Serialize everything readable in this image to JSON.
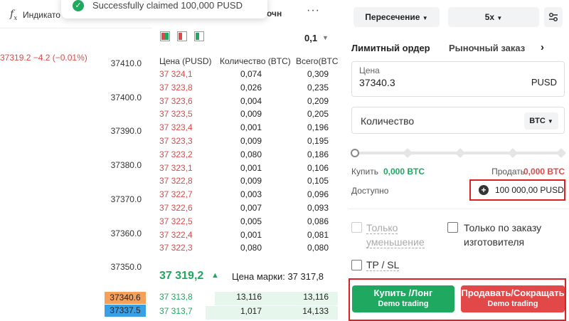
{
  "toast": {
    "message": "Successfully claimed 100,000 PUSD"
  },
  "chart": {
    "indicators_label": "Индикато",
    "price_change": "37319.2  −4.2 (−0.01%)",
    "y_ticks": [
      "37410.0",
      "37400.0",
      "37390.0",
      "37380.0",
      "37370.0",
      "37360.0",
      "37350.0"
    ],
    "price_tags": [
      {
        "value": "37340.6",
        "color": "#f5a15a"
      },
      {
        "value": "37337.5",
        "color": "#3aa0e6"
      }
    ]
  },
  "orderbook": {
    "tab_label": "очн",
    "precision": "0,1",
    "headers": {
      "price": "Цена (PUSD)",
      "qty": "Количество (BTC)",
      "total": "Всего(BTC)"
    },
    "asks": [
      {
        "price": "37 324,1",
        "qty": "0,074",
        "total": "0,309"
      },
      {
        "price": "37 323,8",
        "qty": "0,026",
        "total": "0,235"
      },
      {
        "price": "37 323,6",
        "qty": "0,004",
        "total": "0,209"
      },
      {
        "price": "37 323,5",
        "qty": "0,009",
        "total": "0,205"
      },
      {
        "price": "37 323,4",
        "qty": "0,001",
        "total": "0,196"
      },
      {
        "price": "37 323,3",
        "qty": "0,009",
        "total": "0,195"
      },
      {
        "price": "37 323,2",
        "qty": "0,080",
        "total": "0,186"
      },
      {
        "price": "37 323,1",
        "qty": "0,001",
        "total": "0,106"
      },
      {
        "price": "37 322,8",
        "qty": "0,009",
        "total": "0,105"
      },
      {
        "price": "37 322,7",
        "qty": "0,003",
        "total": "0,096"
      },
      {
        "price": "37 322,6",
        "qty": "0,007",
        "total": "0,093"
      },
      {
        "price": "37 322,5",
        "qty": "0,005",
        "total": "0,086"
      },
      {
        "price": "37 322,4",
        "qty": "0,001",
        "total": "0,081"
      },
      {
        "price": "37 322,3",
        "qty": "0,080",
        "total": "0,080"
      }
    ],
    "last_price": "37 319,2",
    "mark_price_label": "Цена марки: 37 317,8",
    "bids": [
      {
        "price": "37 313,8",
        "qty": "13,116",
        "total": "13,116",
        "depth": 0.66
      },
      {
        "price": "37 313,7",
        "qty": "1,017",
        "total": "14,133",
        "depth": 0.71
      }
    ]
  },
  "order_panel": {
    "margin_mode": "Пересечение",
    "leverage": "5x",
    "tabs": {
      "limit": "Лимитный ордер",
      "market": "Рыночный заказ"
    },
    "price_field": {
      "label": "Цена",
      "value": "37340.3",
      "unit": "PUSD"
    },
    "qty_field": {
      "label": "Количество",
      "unit": "BTC"
    },
    "buy_label": "Купить",
    "buy_value": "0,000 BTC",
    "sell_label": "Продать",
    "sell_value": "0,000 BTC",
    "available_label": "Доступно",
    "available_value": "100 000,00 PUSD",
    "reduce_only": "Только уменьшение",
    "post_only": "Только по заказу изготовителя",
    "tpsl": "TP / SL",
    "buy_button": {
      "label": "Купить /Лонг",
      "sub": "Demo trading"
    },
    "sell_button": {
      "label": "Продавать/Сокращать",
      "sub": "Demo trading"
    }
  }
}
